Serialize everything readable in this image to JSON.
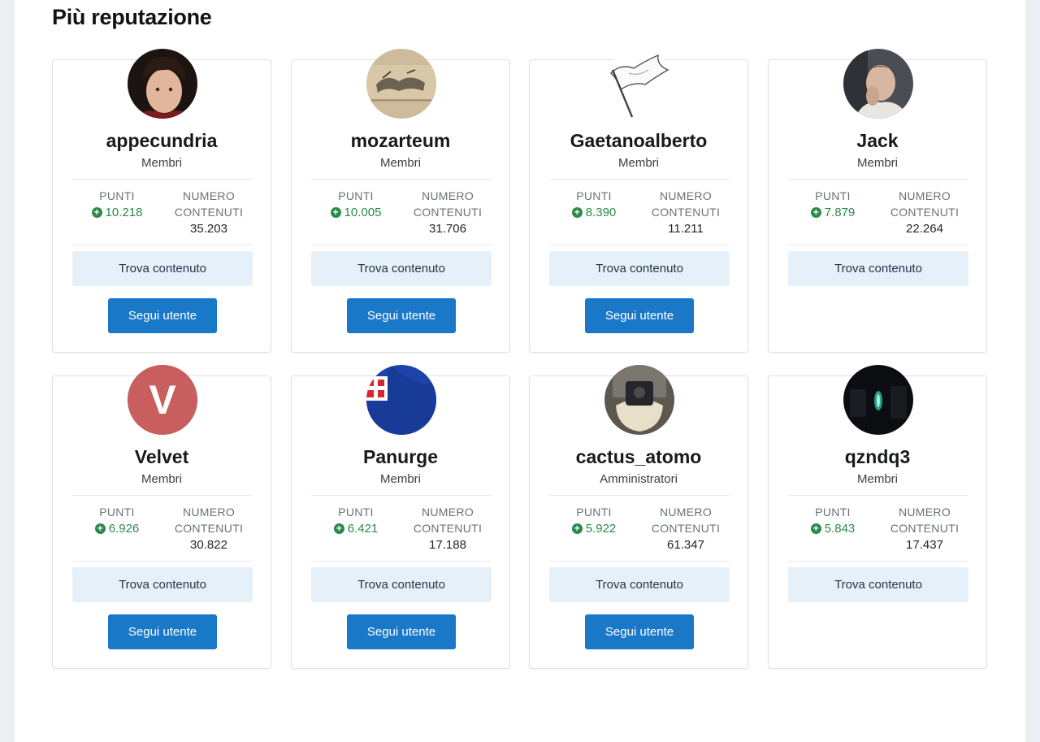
{
  "section_title": "Più reputazione",
  "labels": {
    "points": "PUNTI",
    "contents_line1": "NUMERO",
    "contents_line2": "CONTENUTI",
    "find_content": "Trova contenuto",
    "follow_user": "Segui utente"
  },
  "users": [
    {
      "name": "appecundria",
      "group": "Membri",
      "points": "10.218",
      "contents": "35.203",
      "follow_shown": true
    },
    {
      "name": "mozarteum",
      "group": "Membri",
      "points": "10.005",
      "contents": "31.706",
      "follow_shown": true
    },
    {
      "name": "Gaetanoalberto",
      "group": "Membri",
      "points": "8.390",
      "contents": "11.211",
      "follow_shown": true
    },
    {
      "name": "Jack",
      "group": "Membri",
      "points": "7.879",
      "contents": "22.264",
      "follow_shown": false
    },
    {
      "name": "Velvet",
      "group": "Membri",
      "points": "6.926",
      "contents": "30.822",
      "follow_shown": true,
      "avatar_letter": "V"
    },
    {
      "name": "Panurge",
      "group": "Membri",
      "points": "6.421",
      "contents": "17.188",
      "follow_shown": true
    },
    {
      "name": "cactus_atomo",
      "group": "Amministratori",
      "points": "5.922",
      "contents": "61.347",
      "follow_shown": true
    },
    {
      "name": "qzndq3",
      "group": "Membri",
      "points": "5.843",
      "contents": "17.437",
      "follow_shown": false
    }
  ],
  "colors": {
    "accent": "#1a78c8",
    "points_green": "#2a8a4a",
    "find_bg": "#e5f0f9",
    "velvet_avatar": "#c85e5e"
  }
}
